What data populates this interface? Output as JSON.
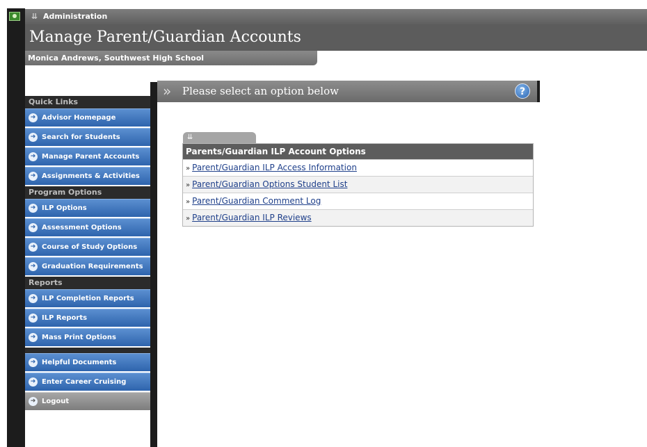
{
  "window": {
    "section_title": "Administration"
  },
  "page": {
    "title": "Manage Parent/Guardian Accounts",
    "user_line": "Monica Andrews, Southwest High School"
  },
  "sidebar": {
    "quick_links_header": "Quick Links",
    "quick_links": [
      "Advisor Homepage",
      "Search for Students",
      "Manage Parent Accounts",
      "Assignments & Activities"
    ],
    "program_options_header": "Program Options",
    "program_options": [
      "ILP Options",
      "Assessment Options",
      "Course of Study Options",
      "Graduation Requirements"
    ],
    "reports_header": "Reports",
    "reports": [
      "ILP Completion Reports",
      "ILP Reports",
      "Mass Print Options"
    ],
    "extra": [
      "Helpful Documents",
      "Enter Career Cruising"
    ],
    "logout": "Logout"
  },
  "main": {
    "option_bar_label": "Please select an option below",
    "help_icon": "?",
    "panel": {
      "header": "Parents/Guardian ILP Account Options",
      "links": [
        "Parent/Guardian ILP Access Information",
        "Parent/Guardian Options Student List",
        "Parent/Guardian Comment Log",
        "Parent/Guardian ILP Reviews"
      ]
    }
  },
  "colors": {
    "sidebar_button": "#2e64ad",
    "header_dark": "#5c5c5c",
    "link": "#1e3f8a"
  }
}
